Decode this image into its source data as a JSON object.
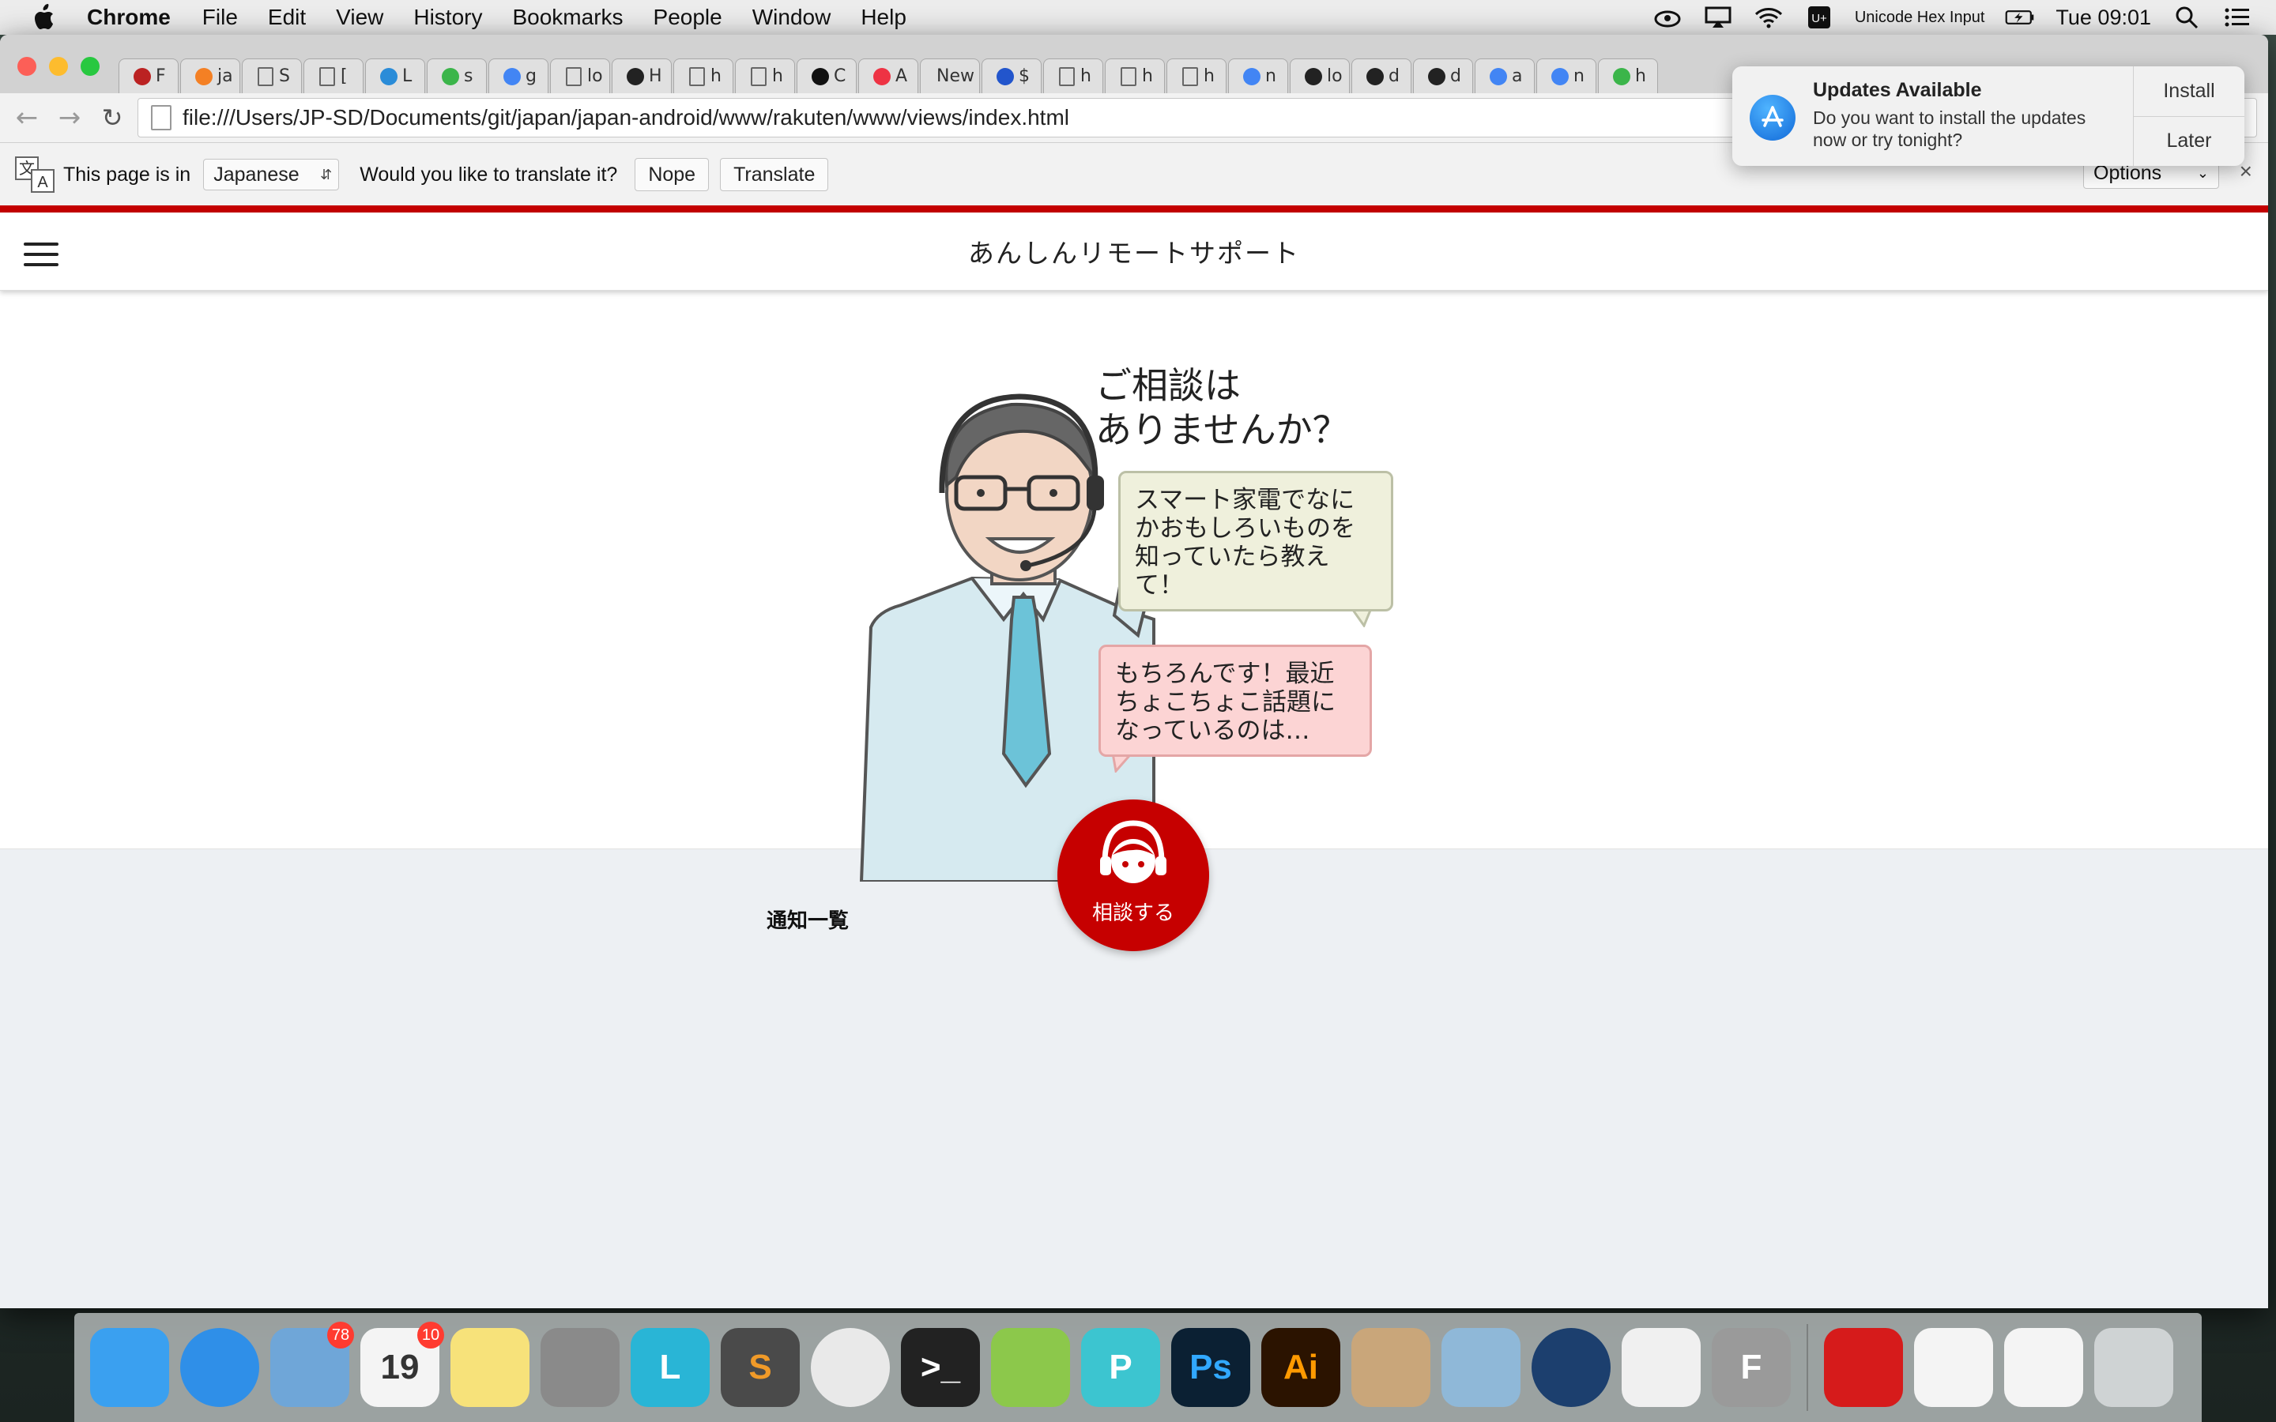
{
  "menubar": {
    "app_name": "Chrome",
    "items": [
      "File",
      "Edit",
      "View",
      "History",
      "Bookmarks",
      "People",
      "Window",
      "Help"
    ],
    "input_source": "Unicode Hex Input",
    "clock": "Tue 09:01"
  },
  "browser": {
    "tabs": [
      {
        "icon": "dinosaur-icon",
        "label": "F"
      },
      {
        "icon": "stack-icon",
        "label": "ja"
      },
      {
        "icon": "page-icon",
        "label": "S"
      },
      {
        "icon": "page-icon",
        "label": "["
      },
      {
        "icon": "play-icon",
        "label": "L"
      },
      {
        "icon": "green-app-icon",
        "label": "s"
      },
      {
        "icon": "google-icon",
        "label": "g"
      },
      {
        "icon": "page-icon",
        "label": "lo"
      },
      {
        "icon": "wikipedia-icon",
        "label": "H"
      },
      {
        "icon": "page-icon",
        "label": "h"
      },
      {
        "icon": "page-icon",
        "label": "h"
      },
      {
        "icon": "github-icon",
        "label": "C"
      },
      {
        "icon": "red-app-icon",
        "label": "A"
      },
      {
        "icon": "text-icon",
        "label": "New"
      },
      {
        "icon": "swirl-icon",
        "label": "$"
      },
      {
        "icon": "page-icon",
        "label": "h"
      },
      {
        "icon": "page-icon",
        "label": "h"
      },
      {
        "icon": "page-icon",
        "label": "h"
      },
      {
        "icon": "google-icon",
        "label": "n"
      },
      {
        "icon": "camera-icon",
        "label": "lo"
      },
      {
        "icon": "cloud-icon",
        "label": "d"
      },
      {
        "icon": "cloud-icon",
        "label": "d"
      },
      {
        "icon": "google-icon",
        "label": "a"
      },
      {
        "icon": "google-icon",
        "label": "n"
      },
      {
        "icon": "green-app-icon",
        "label": "h"
      }
    ],
    "url": "file:///Users/JP-SD/Documents/git/japan/japan-android/www/rakuten/www/views/index.html"
  },
  "translate_bar": {
    "prefix": "This page is in",
    "language": "Japanese",
    "question": "Would you like to translate it?",
    "nope": "Nope",
    "translate": "Translate",
    "options": "Options",
    "close": "×"
  },
  "app": {
    "title": "あんしんリモートサポート",
    "question_line1": "ご相談は",
    "question_line2": "ありませんか？",
    "bubble_question": "スマート家電でなにかおもしろいものを知っていたら教えて！",
    "bubble_answer": "もちろんです！最近ちょこちょこ話題になっているのは…",
    "consult_button": "相談する",
    "notifications_title": "通知一覧",
    "colors": {
      "accent": "#c60000",
      "lower_bg": "#edf0f3"
    }
  },
  "notification": {
    "title": "Updates Available",
    "body": "Do you want to install the updates now or try tonight?",
    "install": "Install",
    "later": "Later"
  },
  "dock": {
    "items": [
      {
        "name": "finder",
        "color": "#3aa0f0",
        "label": ""
      },
      {
        "name": "safari",
        "color": "#2f8fe8",
        "label": ""
      },
      {
        "name": "mail",
        "color": "#6fa6d8",
        "label": "",
        "badge": "78"
      },
      {
        "name": "calendar",
        "color": "#f4f4f4",
        "label": "19",
        "badge": "10"
      },
      {
        "name": "notes",
        "color": "#f7e27a",
        "label": ""
      },
      {
        "name": "system-preferences",
        "color": "#8a8a8a",
        "label": ""
      },
      {
        "name": "launcher",
        "color": "#29b5d6",
        "label": "L"
      },
      {
        "name": "sublime-text",
        "color": "#4a4a4a",
        "label": "S"
      },
      {
        "name": "chrome",
        "color": "#e9e9e9",
        "label": ""
      },
      {
        "name": "terminal",
        "color": "#222222",
        "label": ">_"
      },
      {
        "name": "android-studio",
        "color": "#8cc84b",
        "label": ""
      },
      {
        "name": "phonegap",
        "color": "#3cc5d0",
        "label": "P"
      },
      {
        "name": "photoshop",
        "color": "#0b2033",
        "label": "Ps"
      },
      {
        "name": "illustrator",
        "color": "#2b1300",
        "label": "Ai"
      },
      {
        "name": "calculator",
        "color": "#c9a67a",
        "label": ""
      },
      {
        "name": "preview",
        "color": "#8fb8d8",
        "label": ""
      },
      {
        "name": "sourcetree",
        "color": "#1c3f6e",
        "label": ""
      },
      {
        "name": "numbers",
        "color": "#f0f0f0",
        "label": ""
      },
      {
        "name": "fontforge",
        "color": "#9a9a9a",
        "label": "F"
      },
      {
        "name": "creative-cloud",
        "color": "#d61b1b",
        "label": ""
      },
      {
        "name": "document",
        "color": "#f4f4f4",
        "label": ""
      },
      {
        "name": "document-2",
        "color": "#f4f4f4",
        "label": ""
      },
      {
        "name": "trash",
        "color": "#cfd3d4",
        "label": ""
      }
    ]
  }
}
